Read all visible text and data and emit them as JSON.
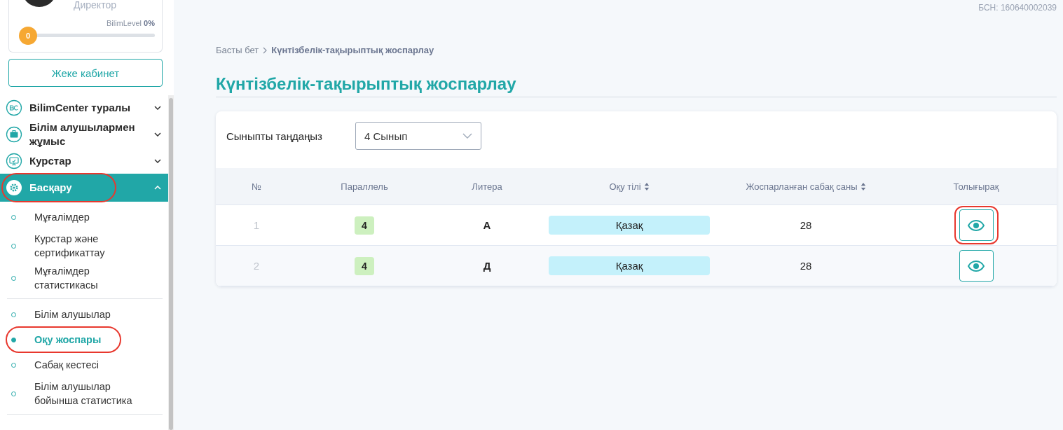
{
  "profile": {
    "role": "Директор",
    "level_text": "BilimLevel **0%**",
    "level_badge": "0",
    "level": 0
  },
  "cabinet_button": "Жеке кабинет",
  "menu": [
    {
      "kind": "bc",
      "label": "BilimCenter туралы",
      "expanded": false,
      "selected": false,
      "circled": false
    },
    {
      "kind": "briefcase",
      "label": "Білім алушылармен жұмыс",
      "expanded": false,
      "selected": false,
      "circled": false
    },
    {
      "kind": "monitor",
      "label": "Курстар",
      "expanded": false,
      "selected": false,
      "circled": false
    },
    {
      "kind": "gear",
      "label": "Басқару",
      "expanded": true,
      "selected": true,
      "circled": true,
      "groups": [
        {
          "items": [
            {
              "label": "Мұғалімдер",
              "selected": false,
              "circled": false
            },
            {
              "label": "Курстар және сертификаттау",
              "selected": false,
              "circled": false
            },
            {
              "label": "Мұғалімдер статистикасы",
              "selected": false,
              "circled": false
            }
          ]
        },
        {
          "items": [
            {
              "label": "Білім алушылар",
              "selected": false,
              "circled": false
            },
            {
              "label": "Оқу жоспары",
              "selected": true,
              "circled": true
            },
            {
              "label": "Сабақ кестесі",
              "selected": false,
              "circled": false
            },
            {
              "label": "Білім алушылар бойынша статистика",
              "selected": false,
              "circled": false
            }
          ]
        }
      ]
    }
  ],
  "bsn": "БСН: 160640002039",
  "breadcrumb": [
    {
      "label": "Басты бет",
      "current": false
    },
    {
      "label": "Күнтізбелік-тақырыптық жоспарлау",
      "current": true
    }
  ],
  "title": "Күнтізбелік-тақырыптық жоспарлау",
  "filter": {
    "label": "Сыныпты таңдаңыз",
    "value": "4 Сынып"
  },
  "table": {
    "columns": [
      {
        "label": "№",
        "sortable": false
      },
      {
        "label": "Параллель",
        "sortable": false
      },
      {
        "label": "Литера",
        "sortable": false
      },
      {
        "label": "Оқу тілі",
        "sortable": true
      },
      {
        "label": "Жоспарланған сабақ саны",
        "sortable": true
      },
      {
        "label": "Толығырақ",
        "sortable": false
      }
    ],
    "rows": [
      {
        "number": "1",
        "parallel": "4",
        "litera": "А",
        "language": "Қазақ",
        "lessons": "28",
        "circled": true
      },
      {
        "number": "2",
        "parallel": "4",
        "litera": "Д",
        "language": "Қазақ",
        "lessons": "28",
        "circled": false
      }
    ]
  }
}
